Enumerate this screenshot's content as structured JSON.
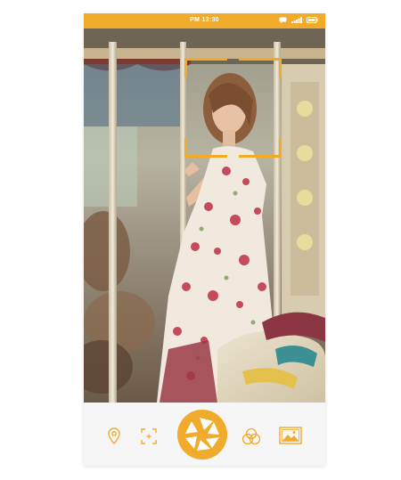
{
  "status_bar": {
    "time": "PM 13:30"
  },
  "colors": {
    "accent": "#f0aa2c",
    "toolbar_bg": "#f6f6f6"
  },
  "toolbar": {
    "icons": [
      "location-pin-icon",
      "focus-target-icon",
      "shutter-aperture-icon",
      "color-filters-icon",
      "gallery-image-icon"
    ]
  }
}
